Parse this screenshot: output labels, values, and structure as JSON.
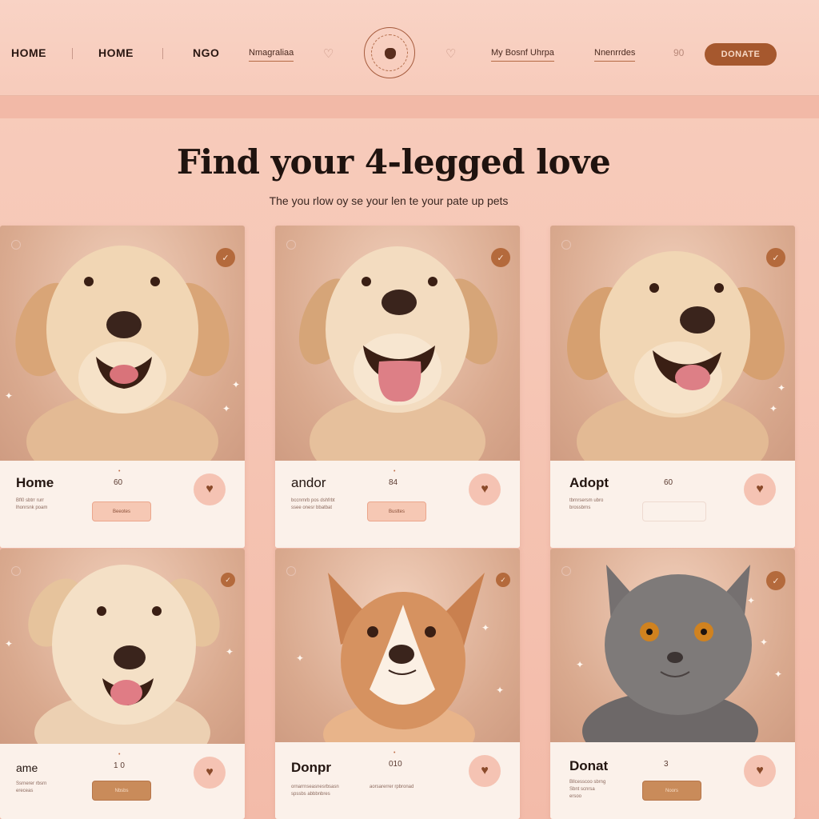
{
  "nav": {
    "items": [
      "HOME",
      "HOME",
      "NGO"
    ],
    "links": [
      "Nmagraliaa",
      "My Bosnf Uhrpa",
      "Nnenrrdes"
    ],
    "paws_text": "90",
    "donate_label": "DONATE",
    "logo_label": "Pet adoption emblem"
  },
  "hero": {
    "title": "Find your 4-legged love",
    "subtitle": "The you rlow oy se your len te your pate up pets"
  },
  "cards": [
    {
      "pet": "golden-retriever",
      "name": "Home",
      "value": "60",
      "tick": "•",
      "desc": "Bfl0 sbtrr rurr\nlhonrsnk poam",
      "button": "Beeotes",
      "button_style": "pink",
      "heart": "♥"
    },
    {
      "pet": "golden-retriever-tongue",
      "name": "andor",
      "value": "84",
      "tick": "•",
      "desc": "bccnrnrb pos dshfrbt\nssee onesr bbatbat",
      "button": "Busttes",
      "button_style": "pink",
      "heart": "♥"
    },
    {
      "pet": "golden-retriever-smile",
      "name": "Adopt",
      "value": "60",
      "tick": "",
      "desc": "tbrnrsersm ubro\nbrossbrns",
      "button": "",
      "button_style": "light",
      "heart": "♥"
    },
    {
      "pet": "cream-puppy",
      "name": "ame",
      "value": "1 0",
      "tick": "•",
      "desc": "Ssrnerer rbsrn\nereceas",
      "button": "Nbsbs",
      "button_style": "dark",
      "heart": "♥"
    },
    {
      "pet": "corgi-puppy",
      "name": "Donpr",
      "value": "010",
      "tick": "•",
      "desc": "ornarrnseasnesrbsasn\nspssbs abbbnbres",
      "desc2": "aorsarerrer rpbronad",
      "button": "",
      "button_style": "none",
      "heart": "♥"
    },
    {
      "pet": "british-shorthair-cat",
      "name": "Donat",
      "value": "3",
      "tick": "",
      "desc": "Bllcesscoo sbrng\nSbnt scnrsa\nersoo",
      "button": "Noors",
      "button_style": "dark",
      "heart": "♥"
    }
  ],
  "colors": {
    "background": "#f6c7b6",
    "accent": "#a6582e",
    "card_info": "#fbf1ea",
    "heart_bg": "#f5c3b3"
  }
}
